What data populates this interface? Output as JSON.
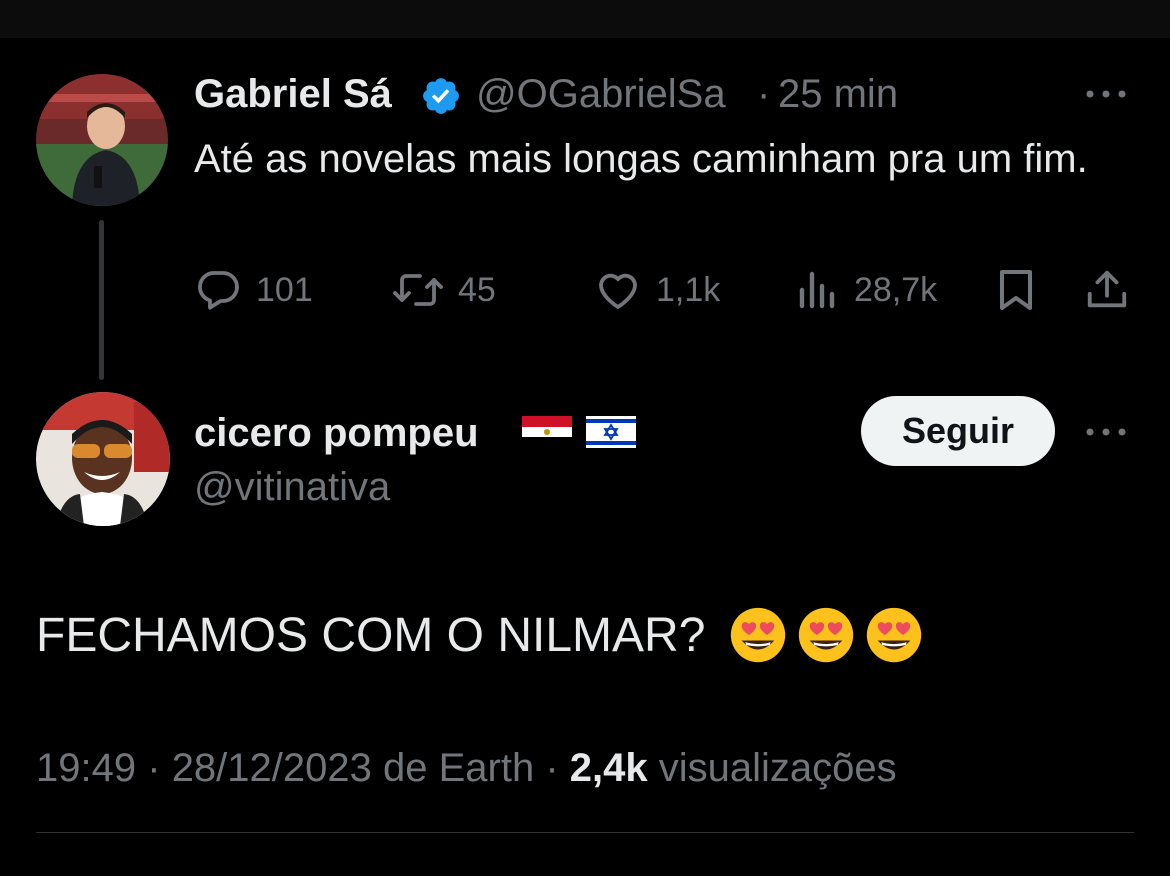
{
  "thread": {
    "parent": {
      "author_name": "Gabriel Sá",
      "handle": "@OGabrielSa",
      "separator": "·",
      "time": "25 min",
      "text": "Até as novelas mais longas caminham pra um fim.",
      "verified": true,
      "counts": {
        "replies": "101",
        "retweets": "45",
        "likes": "1,1k",
        "views": "28,7k"
      }
    },
    "reply": {
      "author_name": "cicero pompeu",
      "handle": "@vitinativa",
      "follow_label": "Seguir",
      "text": "FECHAMOS COM O NILMAR?",
      "emojis": [
        "heart-eyes-emoji",
        "heart-eyes-emoji",
        "heart-eyes-emoji"
      ],
      "flags": [
        "egypt-flag",
        "israel-flag"
      ],
      "meta": {
        "time": "19:49",
        "sep1": "·",
        "date_source": "28/12/2023 de Earth",
        "sep2": "·",
        "views_count": "2,4k",
        "views_label": "visualizações"
      }
    }
  },
  "colors": {
    "background": "#000000",
    "primary_text": "#e7e9ea",
    "secondary_text": "#71767b",
    "verified_blue": "#1d9bf0",
    "follow_button_bg": "#eff3f4"
  }
}
